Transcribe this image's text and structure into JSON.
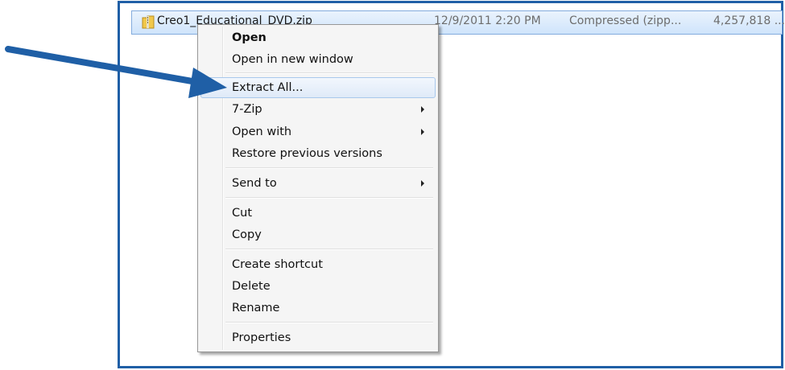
{
  "file": {
    "name": "Creo1_Educational_DVD.zip",
    "date_modified": "12/9/2011 2:20 PM",
    "type": "Compressed (zipp...",
    "size": "4,257,818 ..."
  },
  "context_menu": {
    "items": [
      {
        "label": "Open"
      },
      {
        "label": "Open in new window"
      },
      {
        "label": "Extract All..."
      },
      {
        "label": "7-Zip"
      },
      {
        "label": "Open with"
      },
      {
        "label": "Restore previous versions"
      },
      {
        "label": "Send to"
      },
      {
        "label": "Cut"
      },
      {
        "label": "Copy"
      },
      {
        "label": "Create shortcut"
      },
      {
        "label": "Delete"
      },
      {
        "label": "Rename"
      },
      {
        "label": "Properties"
      }
    ]
  },
  "colors": {
    "frame_border": "#1f5fa6",
    "pointer_arrow": "#1f5fa6",
    "selection": "#cfe4fb"
  },
  "icons": {
    "file": "zip-folder-icon",
    "pointer": "arrow-pointer-icon",
    "submenu": "chevron-right-icon"
  }
}
